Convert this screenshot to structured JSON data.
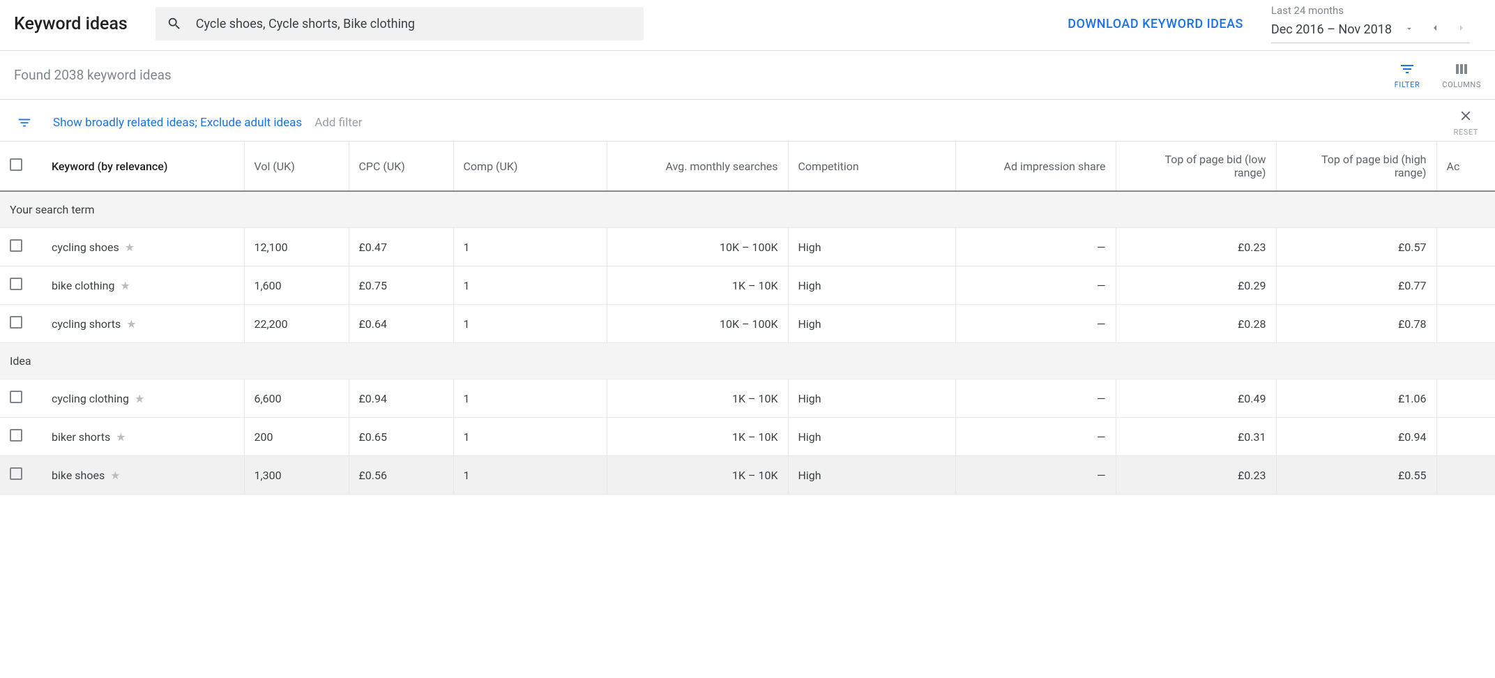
{
  "header": {
    "title": "Keyword ideas",
    "search_text": "Cycle shoes, Cycle shorts, Bike clothing",
    "download_label": "DOWNLOAD KEYWORD IDEAS",
    "date_range_caption": "Last 24 months",
    "date_range_value": "Dec 2016 – Nov 2018"
  },
  "found_bar": {
    "found_text": "Found 2038 keyword ideas",
    "filter_label": "FILTER",
    "columns_label": "COLUMNS"
  },
  "filters_bar": {
    "applied": "Show broadly related ideas; Exclude adult ideas",
    "add_filter": "Add filter",
    "reset": "RESET"
  },
  "table": {
    "columns": {
      "keyword": "Keyword (by relevance)",
      "vol": "Vol (UK)",
      "cpc": "CPC (UK)",
      "comp1": "Comp (UK)",
      "avg": "Avg. monthly searches",
      "comp2": "Competition",
      "ad_share": "Ad impression share",
      "bid_low1": "Top of page bid (low",
      "bid_low2": "range)",
      "bid_high1": "Top of page bid (high",
      "bid_high2": "range)",
      "account": "Ac"
    },
    "sections": {
      "search_term": "Your search term",
      "idea": "Idea"
    },
    "search_term_rows": [
      {
        "kw": "cycling shoes",
        "vol": "12,100",
        "cpc": "£0.47",
        "comp1": "1",
        "avg": "10K – 100K",
        "comp2": "High",
        "ad": "—",
        "low": "£0.23",
        "high": "£0.57"
      },
      {
        "kw": "bike clothing",
        "vol": "1,600",
        "cpc": "£0.75",
        "comp1": "1",
        "avg": "1K – 10K",
        "comp2": "High",
        "ad": "—",
        "low": "£0.29",
        "high": "£0.77"
      },
      {
        "kw": "cycling shorts",
        "vol": "22,200",
        "cpc": "£0.64",
        "comp1": "1",
        "avg": "10K – 100K",
        "comp2": "High",
        "ad": "—",
        "low": "£0.28",
        "high": "£0.78"
      }
    ],
    "idea_rows": [
      {
        "kw": "cycling clothing",
        "vol": "6,600",
        "cpc": "£0.94",
        "comp1": "1",
        "avg": "1K – 10K",
        "comp2": "High",
        "ad": "—",
        "low": "£0.49",
        "high": "£1.06"
      },
      {
        "kw": "biker shorts",
        "vol": "200",
        "cpc": "£0.65",
        "comp1": "1",
        "avg": "1K – 10K",
        "comp2": "High",
        "ad": "—",
        "low": "£0.31",
        "high": "£0.94"
      },
      {
        "kw": "bike shoes",
        "vol": "1,300",
        "cpc": "£0.56",
        "comp1": "1",
        "avg": "1K – 10K",
        "comp2": "High",
        "ad": "—",
        "low": "£0.23",
        "high": "£0.55",
        "highlight": true
      }
    ]
  }
}
